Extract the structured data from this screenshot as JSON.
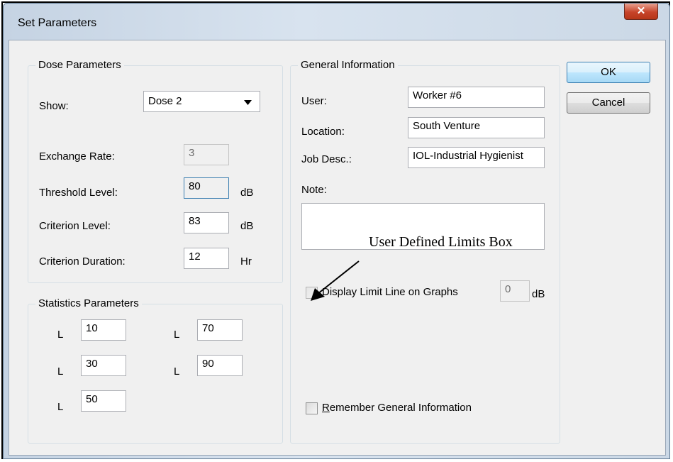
{
  "window": {
    "title": "Set Parameters",
    "close_glyph": "✕"
  },
  "buttons": {
    "ok": "OK",
    "cancel": "Cancel"
  },
  "dose": {
    "title": "Dose Parameters",
    "show_label": "Show:",
    "show_value": "Dose 2",
    "exchange_label": "Exchange Rate:",
    "exchange_value": "3",
    "threshold_label": "Threshold Level:",
    "threshold_value": "80",
    "threshold_unit": "dB",
    "criterion_label": "Criterion Level:",
    "criterion_value": "83",
    "criterion_unit": "dB",
    "duration_label": "Criterion Duration:",
    "duration_value": "12",
    "duration_unit": "Hr"
  },
  "stats": {
    "title": "Statistics Parameters",
    "prefix": "L",
    "l1": "10",
    "l2": "70",
    "l3": "30",
    "l4": "90",
    "l5": "50"
  },
  "general": {
    "title": "General Information",
    "user_label": "User:",
    "user_value": "Worker #6",
    "location_label": "Location:",
    "location_value": "South Venture",
    "job_label": "Job Desc.:",
    "job_value": "IOL-Industrial Hygienist",
    "note_label": "Note:",
    "note_value": "",
    "limit_label": "Display Limit Line on Graphs",
    "limit_value": "0",
    "limit_unit": "dB",
    "remember_label_first": "R",
    "remember_label_rest": "emember General Information"
  },
  "annotation": "User Defined Limits Box",
  "icons": {
    "dropdown": "chevron-down-icon",
    "close": "close-icon",
    "arrow": "annotation-arrow-icon"
  }
}
